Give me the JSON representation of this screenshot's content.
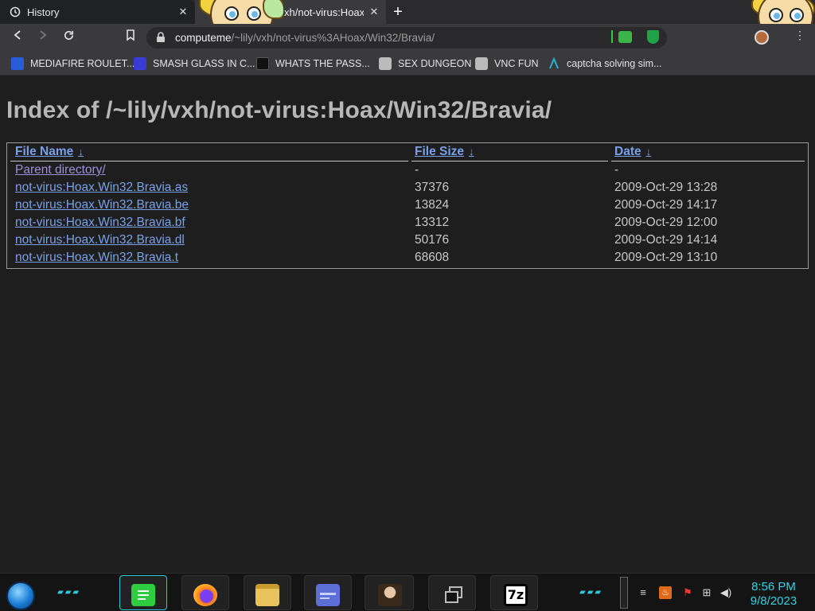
{
  "browser": {
    "tabs": [
      {
        "title": "History",
        "icon": "history-icon"
      },
      {
        "title": "xh/not-virus:Hoax/",
        "icon": "page-icon"
      }
    ],
    "new_tab_label": "+",
    "close_glyph": "✕",
    "url_host": "computeme",
    "url_path": "/~lily/vxh/not-virus%3AHoax/Win32/Bravia/"
  },
  "bookmarks": [
    {
      "label": "MEDIAFIRE ROULET...",
      "icon": "mediafire-icon",
      "icon_color": "#2a5bd7"
    },
    {
      "label": "SMASH GLASS IN C...",
      "icon": "smash-glass-icon",
      "icon_color": "#3b3bd8"
    },
    {
      "label": "WHATS THE PASS...",
      "icon": "terminal-icon",
      "icon_color": "#111111"
    },
    {
      "label": "SEX DUNGEON",
      "icon": "cube-icon",
      "icon_color": "#bbbbbb"
    },
    {
      "label": "VNC FUN",
      "icon": "cube-icon",
      "icon_color": "#bbbbbb"
    },
    {
      "label": "captcha solving sim...",
      "icon": "arrow-up-icon",
      "icon_color": "#2ab3c8"
    }
  ],
  "page": {
    "title": "Index of /~lily/vxh/not-virus:Hoax/Win32/Bravia/",
    "columns": [
      "File Name",
      "File Size",
      "Date"
    ],
    "sort_arrow": "↓",
    "rows": [
      {
        "name": "Parent directory/",
        "size": "-",
        "date": "-"
      },
      {
        "name": "not-virus:Hoax.Win32.Bravia.as",
        "size": "37376",
        "date": "2009-Oct-29 13:28"
      },
      {
        "name": "not-virus:Hoax.Win32.Bravia.be",
        "size": "13824",
        "date": "2009-Oct-29 14:17"
      },
      {
        "name": "not-virus:Hoax.Win32.Bravia.bf",
        "size": "13312",
        "date": "2009-Oct-29 12:00"
      },
      {
        "name": "not-virus:Hoax.Win32.Bravia.dl",
        "size": "50176",
        "date": "2009-Oct-29 14:14"
      },
      {
        "name": "not-virus:Hoax.Win32.Bravia.t",
        "size": "68608",
        "date": "2009-Oct-29 13:10"
      }
    ]
  },
  "taskbar": {
    "apps": [
      {
        "name": "chat-app-icon",
        "color": "#2ecc40"
      },
      {
        "name": "firefox-icon",
        "color": "#ff7a18"
      },
      {
        "name": "file-explorer-icon",
        "color": "#e8c25a"
      },
      {
        "name": "card-app-icon",
        "color": "#5d6fd6"
      },
      {
        "name": "portrait-app-icon",
        "color": "#8a6a4c"
      },
      {
        "name": "windows-switcher-icon",
        "color": "#9a9a9a"
      },
      {
        "name": "7zip-icon",
        "color": "#ffffff"
      }
    ],
    "sevenzip_label": "7z",
    "time": "8:56 PM",
    "date": "9/8/2023"
  },
  "theme": {
    "page_bg": "#1e1e1e",
    "link_color": "#7aa0e8",
    "visited_link_color": "#9e8fd8",
    "heading_color": "#b7b7b7",
    "clock_color": "#2ed3e6"
  }
}
